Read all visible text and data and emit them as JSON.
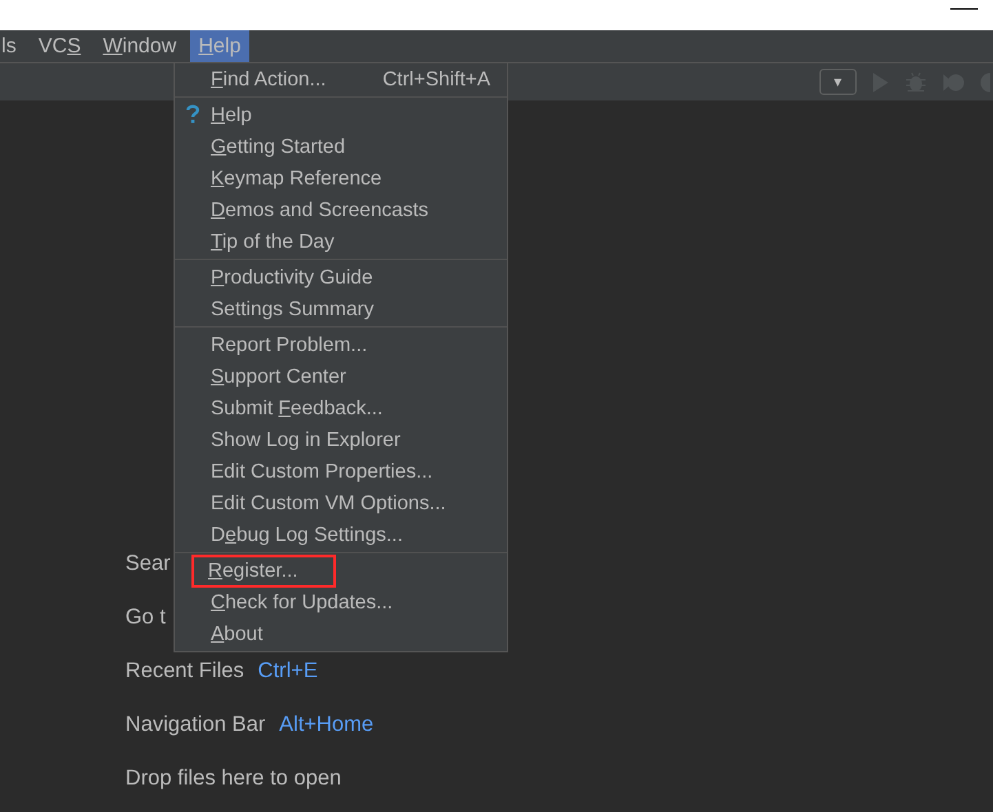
{
  "menubar": [
    {
      "label": "ls",
      "selected": false
    },
    {
      "pre": "VC",
      "key": "S",
      "selected": false
    },
    {
      "key": "W",
      "post": "indow",
      "selected": false
    },
    {
      "key": "H",
      "post": "elp",
      "selected": true
    }
  ],
  "toolbar": {
    "dropdown": {
      "symbol": "▾"
    }
  },
  "welcome": [
    {
      "text": "Sear"
    },
    {
      "text": "Go t"
    },
    {
      "text": "Recent Files",
      "shortcut": "Ctrl+E"
    },
    {
      "text": "Navigation Bar",
      "shortcut": "Alt+Home"
    },
    {
      "text": "Drop files here to open"
    }
  ],
  "help_menu": {
    "groups": [
      [
        {
          "kind": "plain",
          "key": "F",
          "post": "ind Action...",
          "shortcut": "Ctrl+Shift+A",
          "highlighted": false
        }
      ],
      [
        {
          "kind": "help",
          "key": "H",
          "post": "elp",
          "highlighted": false
        },
        {
          "kind": "plain",
          "key": "G",
          "post": "etting Started",
          "highlighted": false
        },
        {
          "kind": "plain",
          "key": "K",
          "post": "eymap Reference",
          "highlighted": false
        },
        {
          "kind": "plain",
          "key": "D",
          "post": "emos and Screencasts",
          "highlighted": false
        },
        {
          "kind": "plain",
          "key": "T",
          "post": "ip of the Day",
          "highlighted": false
        }
      ],
      [
        {
          "kind": "plain",
          "key": "P",
          "post": "roductivity Guide",
          "highlighted": false
        },
        {
          "kind": "plain",
          "label": "Settings Summary",
          "highlighted": false
        }
      ],
      [
        {
          "kind": "plain",
          "label": "Report Problem...",
          "highlighted": false
        },
        {
          "kind": "plain",
          "key": "S",
          "post": "upport Center",
          "highlighted": false
        },
        {
          "kind": "plain",
          "pre": "Submit ",
          "key": "F",
          "post": "eedback...",
          "highlighted": false
        },
        {
          "kind": "plain",
          "label": "Show Log in Explorer",
          "highlighted": false
        },
        {
          "kind": "plain",
          "label": "Edit Custom Properties...",
          "highlighted": false
        },
        {
          "kind": "plain",
          "label": "Edit Custom VM Options...",
          "highlighted": false
        },
        {
          "kind": "plain",
          "pre": "D",
          "key": "e",
          "post": "bug Log Settings...",
          "highlighted": false
        }
      ],
      [
        {
          "kind": "plain",
          "key": "R",
          "post": "egister...",
          "highlighted": true
        },
        {
          "kind": "plain",
          "key": "C",
          "post": "heck for Updates...",
          "highlighted": false
        },
        {
          "kind": "plain",
          "key": "A",
          "post": "bout",
          "highlighted": false
        }
      ]
    ]
  }
}
